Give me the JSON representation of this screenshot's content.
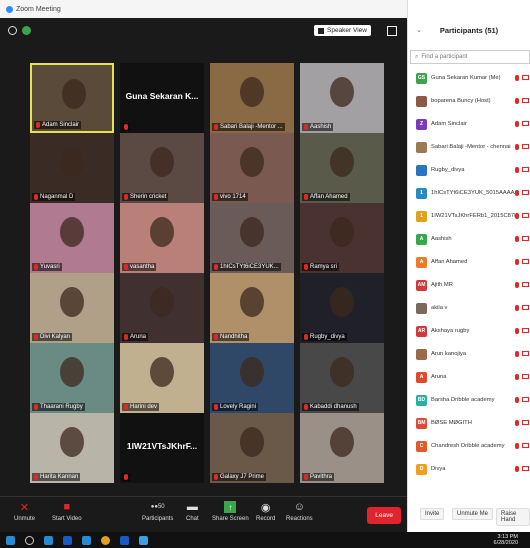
{
  "window": {
    "title": "Zoom Meeting"
  },
  "controls": {
    "speaker_view": "Speaker View"
  },
  "tiles": [
    {
      "label": "Adam Sinclair",
      "bg": "#5a4a3a",
      "active": true
    },
    {
      "label": "Guna Sekaran K...",
      "bg": "#111111",
      "nameonly": true
    },
    {
      "label": "Sabari Balaji -Mentor ...",
      "bg": "#8a6a44"
    },
    {
      "label": "Aashish",
      "bg": "#a2a0a2"
    },
    {
      "label": "Naganmal D",
      "bg": "#3a2c24"
    },
    {
      "label": "Sherin cricket",
      "bg": "#5b4a44"
    },
    {
      "label": "vivo 1714",
      "bg": "#7a5a50"
    },
    {
      "label": "Affan Ahamed",
      "bg": "#5a5a4a"
    },
    {
      "label": "Yuvasri",
      "bg": "#b07a90"
    },
    {
      "label": "vasantha",
      "bg": "#b88078"
    },
    {
      "label": "1hICsTYt6iCE3YUK...",
      "bg": "#6a5a58"
    },
    {
      "label": "Ramya sri",
      "bg": "#4a3230"
    },
    {
      "label": "Divi Kalyan",
      "bg": "#b0a088"
    },
    {
      "label": "Aruna",
      "bg": "#403030"
    },
    {
      "label": "Nandhitha",
      "bg": "#b09068"
    },
    {
      "label": "Rugby_divya",
      "bg": "#202028"
    },
    {
      "label": "Thaarani Rugby",
      "bg": "#6a8a84"
    },
    {
      "label": "Harini dev",
      "bg": "#c0b090"
    },
    {
      "label": "Lovely Ragini",
      "bg": "#304868"
    },
    {
      "label": "Kabaddi dhanush",
      "bg": "#484848"
    },
    {
      "label": "Harita Kannan",
      "bg": "#b8b4a8"
    },
    {
      "label": "1IW21VTsJKhrF...",
      "bg": "#111111",
      "nameonly": true
    },
    {
      "label": "Galaxy J7 Prime",
      "bg": "#6a5848"
    },
    {
      "label": "Pavithra",
      "bg": "#9a9088"
    }
  ],
  "toolbar": {
    "unmute": "Unmute",
    "start_video": "Start Video",
    "participants": "Participants",
    "participants_count": "50",
    "chat": "Chat",
    "share_screen": "Share Screen",
    "record": "Record",
    "reactions": "Reactions",
    "leave": "Leave"
  },
  "panel": {
    "title": "Participants (51)",
    "search_placeholder": "Find a participant",
    "participants": [
      {
        "name": "Guna Sekaran Kumar (Me)",
        "initials": "GS",
        "color": "#3aa64c"
      },
      {
        "name": "boparena Buncy (Host)",
        "initials": "",
        "color": "#8a5a44"
      },
      {
        "name": "Adam Sinclair",
        "initials": "Z",
        "color": "#7a3ac0"
      },
      {
        "name": "Sabari Balaji -Mentor - chennai",
        "initials": "",
        "color": "#9a7a54"
      },
      {
        "name": "Rugby_divya",
        "initials": "",
        "color": "#2a74c0"
      },
      {
        "name": "1hICsTYt6iCE3YUK_5015AAAAA...",
        "initials": "1",
        "color": "#2a8ac0"
      },
      {
        "name": "1IW21VTsJKhrFERb1_2015C87K...",
        "initials": "1",
        "color": "#e0a020"
      },
      {
        "name": "Aashish",
        "initials": "A",
        "color": "#3aa64c"
      },
      {
        "name": "Affan Ahamed",
        "initials": "A",
        "color": "#f07a2a"
      },
      {
        "name": "Ajith MR",
        "initials": "AM",
        "color": "#d03a3a"
      },
      {
        "name": "akila v",
        "initials": "",
        "color": "#7a6a5a"
      },
      {
        "name": "Akshaya rugby",
        "initials": "AR",
        "color": "#d03a3a"
      },
      {
        "name": "Arun kanojiya",
        "initials": "",
        "color": "#9a6a4a"
      },
      {
        "name": "Aruna",
        "initials": "A",
        "color": "#e04a2a"
      },
      {
        "name": "Barsha Dribble academy",
        "initials": "BD",
        "color": "#2ab0a0"
      },
      {
        "name": "BØSE MØGITH",
        "initials": "BM",
        "color": "#e04a3a"
      },
      {
        "name": "Chandresh Dribble academy",
        "initials": "C",
        "color": "#e05a2a"
      },
      {
        "name": "Divya",
        "initials": "D",
        "color": "#f0a020"
      }
    ],
    "invite": "Invite",
    "unmute_me": "Unmute Me",
    "raise_hand": "Raise Hand"
  },
  "taskbar": {
    "time": "3:13 PM",
    "date": "6/28/2020"
  }
}
